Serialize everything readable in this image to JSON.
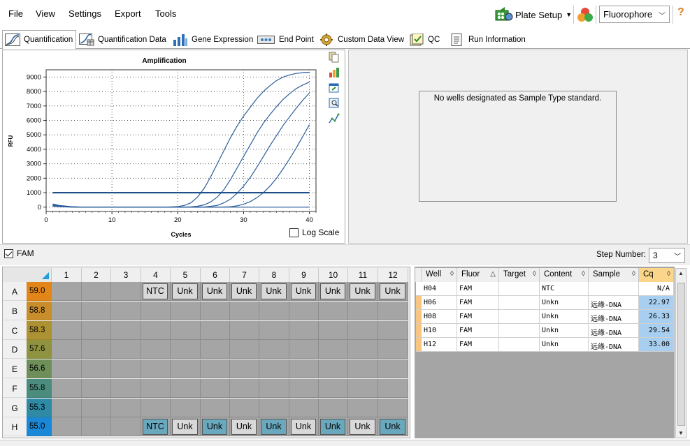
{
  "menu": [
    "File",
    "View",
    "Settings",
    "Export",
    "Tools"
  ],
  "toolbar": {
    "plate_setup": "Plate Setup",
    "fluorophore": "Fluorophore",
    "help": "?"
  },
  "tabs": [
    {
      "label": "Quantification",
      "icon": "amplification-chart-icon",
      "active": true
    },
    {
      "label": "Quantification Data",
      "icon": "quant-data-icon"
    },
    {
      "label": "Gene Expression",
      "icon": "bar-chart-icon"
    },
    {
      "label": "End Point",
      "icon": "end-point-icon"
    },
    {
      "label": "Custom Data View",
      "icon": "gear-icon"
    },
    {
      "label": "QC",
      "icon": "qc-check-icon"
    },
    {
      "label": "Run Information",
      "icon": "document-icon"
    }
  ],
  "chart_data": {
    "type": "line",
    "title": "Amplification",
    "xlabel": "Cycles",
    "ylabel": "RFU",
    "xlim": [
      0,
      41
    ],
    "ylim": [
      -300,
      9500
    ],
    "xticks": [
      0,
      10,
      20,
      30,
      40
    ],
    "yticks": [
      0,
      1000,
      2000,
      3000,
      4000,
      5000,
      6000,
      7000,
      8000,
      9000
    ],
    "grid": true,
    "threshold": 1000,
    "series": [
      {
        "well": "H06",
        "cq": 22.97,
        "values_x": [
          1,
          2,
          4,
          6,
          8,
          10,
          12,
          14,
          16,
          18,
          20,
          21,
          22,
          23,
          24,
          25,
          26,
          27,
          28,
          29,
          30,
          31,
          32,
          33,
          34,
          35,
          36,
          37,
          38,
          39,
          40
        ],
        "values_y": [
          150,
          80,
          20,
          0,
          0,
          0,
          0,
          0,
          0,
          0,
          40,
          120,
          300,
          700,
          1300,
          2100,
          3000,
          3900,
          4800,
          5600,
          6300,
          6900,
          7500,
          8000,
          8400,
          8750,
          9000,
          9150,
          9250,
          9300,
          9330
        ]
      },
      {
        "well": "H08",
        "cq": 26.33,
        "values_x": [
          1,
          2,
          4,
          6,
          8,
          10,
          12,
          14,
          16,
          18,
          20,
          22,
          23,
          24,
          25,
          26,
          27,
          28,
          29,
          30,
          31,
          32,
          33,
          34,
          35,
          36,
          37,
          38,
          39,
          40
        ],
        "values_y": [
          220,
          120,
          30,
          0,
          0,
          0,
          0,
          0,
          0,
          0,
          0,
          20,
          60,
          160,
          360,
          700,
          1200,
          1900,
          2700,
          3500,
          4300,
          5100,
          5800,
          6400,
          6950,
          7450,
          7850,
          8200,
          8450,
          8650
        ]
      },
      {
        "well": "H10",
        "cq": 29.54,
        "values_x": [
          1,
          2,
          4,
          6,
          8,
          10,
          12,
          14,
          16,
          18,
          20,
          22,
          24,
          26,
          27,
          28,
          29,
          30,
          31,
          32,
          33,
          34,
          35,
          36,
          37,
          38,
          39,
          40
        ],
        "values_y": [
          180,
          90,
          20,
          0,
          0,
          0,
          0,
          0,
          0,
          0,
          0,
          0,
          10,
          120,
          300,
          550,
          950,
          1450,
          2050,
          2750,
          3500,
          4250,
          4950,
          5650,
          6250,
          6850,
          7400,
          7900
        ]
      },
      {
        "well": "H12",
        "cq": 33.0,
        "values_x": [
          1,
          2,
          4,
          6,
          8,
          10,
          12,
          14,
          16,
          18,
          20,
          22,
          24,
          26,
          28,
          29,
          30,
          31,
          32,
          33,
          34,
          35,
          36,
          37,
          38,
          39,
          40
        ],
        "values_y": [
          120,
          60,
          10,
          0,
          0,
          0,
          0,
          0,
          0,
          0,
          0,
          0,
          0,
          0,
          30,
          90,
          200,
          380,
          650,
          1000,
          1450,
          2000,
          2650,
          3350,
          4100,
          4900,
          5700
        ]
      },
      {
        "well": "H04",
        "cq": null,
        "values_x": [
          1,
          2,
          4,
          6,
          10,
          20,
          30,
          40
        ],
        "values_y": [
          60,
          30,
          0,
          0,
          0,
          0,
          0,
          0
        ]
      }
    ],
    "log_scale_label": "Log Scale",
    "log_scale": false
  },
  "standard_curve": {
    "message": "No wells designated as Sample Type standard."
  },
  "fluor_filter": {
    "label": "FAM",
    "checked": true
  },
  "step": {
    "label": "Step Number:",
    "value": "3"
  },
  "plate": {
    "columns": [
      "1",
      "2",
      "3",
      "4",
      "5",
      "6",
      "7",
      "8",
      "9",
      "10",
      "11",
      "12"
    ],
    "rows": [
      {
        "label": "A",
        "temp": "59.0",
        "temp_color": "#e3861a"
      },
      {
        "label": "B",
        "temp": "58.8",
        "temp_color": "#c88e2b"
      },
      {
        "label": "C",
        "temp": "58.3",
        "temp_color": "#ad9234"
      },
      {
        "label": "D",
        "temp": "57.6",
        "temp_color": "#8f933f"
      },
      {
        "label": "E",
        "temp": "56.6",
        "temp_color": "#6e8f5a"
      },
      {
        "label": "F",
        "temp": "55.8",
        "temp_color": "#4b8c7e"
      },
      {
        "label": "G",
        "temp": "55.3",
        "temp_color": "#2f8aa6"
      },
      {
        "label": "H",
        "temp": "55.0",
        "temp_color": "#1a88d6"
      }
    ],
    "wells": [
      {
        "row": 0,
        "col": 3,
        "label": "NTC",
        "blue": false
      },
      {
        "row": 0,
        "col": 4,
        "label": "Unk",
        "blue": false
      },
      {
        "row": 0,
        "col": 5,
        "label": "Unk",
        "blue": false
      },
      {
        "row": 0,
        "col": 6,
        "label": "Unk",
        "blue": false
      },
      {
        "row": 0,
        "col": 7,
        "label": "Unk",
        "blue": false
      },
      {
        "row": 0,
        "col": 8,
        "label": "Unk",
        "blue": false
      },
      {
        "row": 0,
        "col": 9,
        "label": "Unk",
        "blue": false
      },
      {
        "row": 0,
        "col": 10,
        "label": "Unk",
        "blue": false
      },
      {
        "row": 0,
        "col": 11,
        "label": "Unk",
        "blue": false
      },
      {
        "row": 7,
        "col": 3,
        "label": "NTC",
        "blue": true
      },
      {
        "row": 7,
        "col": 4,
        "label": "Unk",
        "blue": false
      },
      {
        "row": 7,
        "col": 5,
        "label": "Unk",
        "blue": true
      },
      {
        "row": 7,
        "col": 6,
        "label": "Unk",
        "blue": false
      },
      {
        "row": 7,
        "col": 7,
        "label": "Unk",
        "blue": true
      },
      {
        "row": 7,
        "col": 8,
        "label": "Unk",
        "blue": false
      },
      {
        "row": 7,
        "col": 9,
        "label": "Unk",
        "blue": true
      },
      {
        "row": 7,
        "col": 10,
        "label": "Unk",
        "blue": false
      },
      {
        "row": 7,
        "col": 11,
        "label": "Unk",
        "blue": true
      }
    ]
  },
  "results": {
    "headers": [
      "Well",
      "Fluor",
      "Target",
      "Content",
      "Sample",
      "Cq"
    ],
    "rows": [
      {
        "well": "H04",
        "fluor": "FAM",
        "target": "",
        "content": "NTC",
        "sample": "",
        "cq": "N/A",
        "marked": false
      },
      {
        "well": "H06",
        "fluor": "FAM",
        "target": "",
        "content": "Unkn",
        "sample": "远缘-DNA",
        "cq": "22.97",
        "marked": true
      },
      {
        "well": "H08",
        "fluor": "FAM",
        "target": "",
        "content": "Unkn",
        "sample": "远缘-DNA",
        "cq": "26.33",
        "marked": true
      },
      {
        "well": "H10",
        "fluor": "FAM",
        "target": "",
        "content": "Unkn",
        "sample": "远缘-DNA",
        "cq": "29.54",
        "marked": true
      },
      {
        "well": "H12",
        "fluor": "FAM",
        "target": "",
        "content": "Unkn",
        "sample": "远缘-DNA",
        "cq": "33.00",
        "marked": true
      }
    ]
  }
}
